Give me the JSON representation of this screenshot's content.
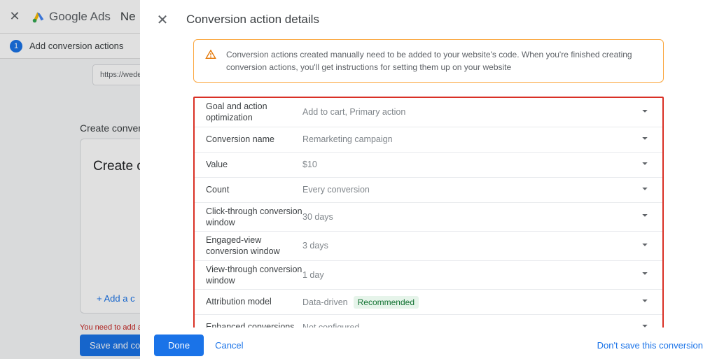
{
  "background": {
    "brand": "Google Ads",
    "page_action": "Ne",
    "step_number": "1",
    "step_label": "Add conversion actions",
    "url_preview": "https://wede",
    "section_title": "Create convers",
    "card_title": "Create co",
    "add_link": "+ Add a c",
    "warning": "You need to add at l",
    "save_button": "Save and contin"
  },
  "modal": {
    "title": "Conversion action details",
    "alert": "Conversion actions created manually need to be added to your website's code. When you're finished creating conversion actions, you'll get instructions for setting them up on your website",
    "rows": [
      {
        "label": "Goal and action optimization",
        "value": "Add to cart, Primary action"
      },
      {
        "label": "Conversion name",
        "value": "Remarketing campaign"
      },
      {
        "label": "Value",
        "value": "$10"
      },
      {
        "label": "Count",
        "value": "Every conversion"
      },
      {
        "label": "Click-through conversion window",
        "value": "30 days"
      },
      {
        "label": "Engaged-view conversion window",
        "value": "3 days"
      },
      {
        "label": "View-through conversion window",
        "value": "1 day"
      },
      {
        "label": "Attribution model",
        "value": "Data-driven",
        "badge": "Recommended"
      },
      {
        "label": "Enhanced conversions",
        "value": "Not configured"
      }
    ],
    "footer": {
      "done": "Done",
      "cancel": "Cancel",
      "dont_save": "Don't save this conversion"
    }
  }
}
